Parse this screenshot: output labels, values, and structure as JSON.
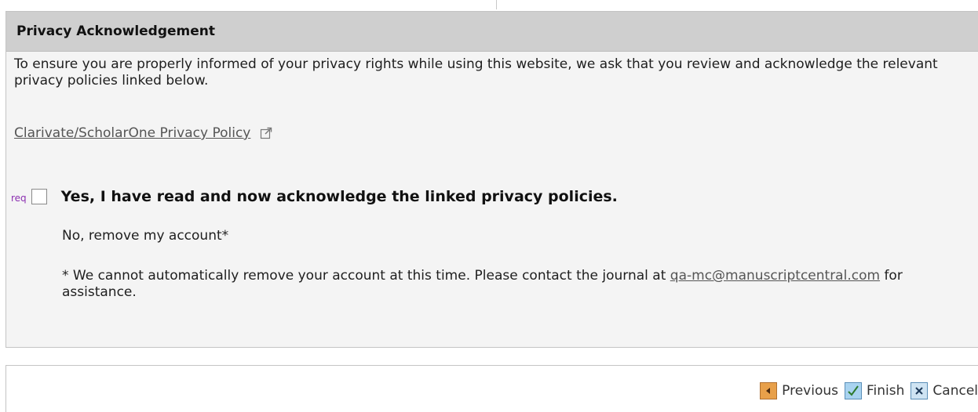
{
  "panel": {
    "title": "Privacy Acknowledgement",
    "intro": "To ensure you are properly informed of your privacy rights while using this website, we ask that you review and acknowledge the relevant privacy policies linked below.",
    "policy_link": "Clarivate/ScholarOne Privacy Policy",
    "req_label": "req",
    "ack_label": "Yes, I have read and now acknowledge the linked privacy policies.",
    "ack_checked": false,
    "remove_option": "No, remove my account*",
    "note_prefix": "* We cannot automatically remove your account at this time. Please contact the journal at ",
    "note_email": "qa-mc@manuscriptcentral.com",
    "note_suffix": " for assistance."
  },
  "footer": {
    "previous_label": "Previous",
    "finish_label": "Finish",
    "cancel_label": "Cancel"
  },
  "icons": {
    "policy_link_icon": "external-link-icon",
    "previous_icon": "arrow-left-icon",
    "finish_icon": "checkmark-icon",
    "cancel_icon": "close-icon"
  },
  "colors": {
    "header_bg": "#cfcfcf",
    "panel_bg": "#f4f4f4",
    "req_color": "#8b2fb0",
    "previous_icon_bg": "#e8a04a",
    "finish_icon_bg": "#8fc3e8",
    "cancel_icon_bg": "#bcd9ee"
  }
}
